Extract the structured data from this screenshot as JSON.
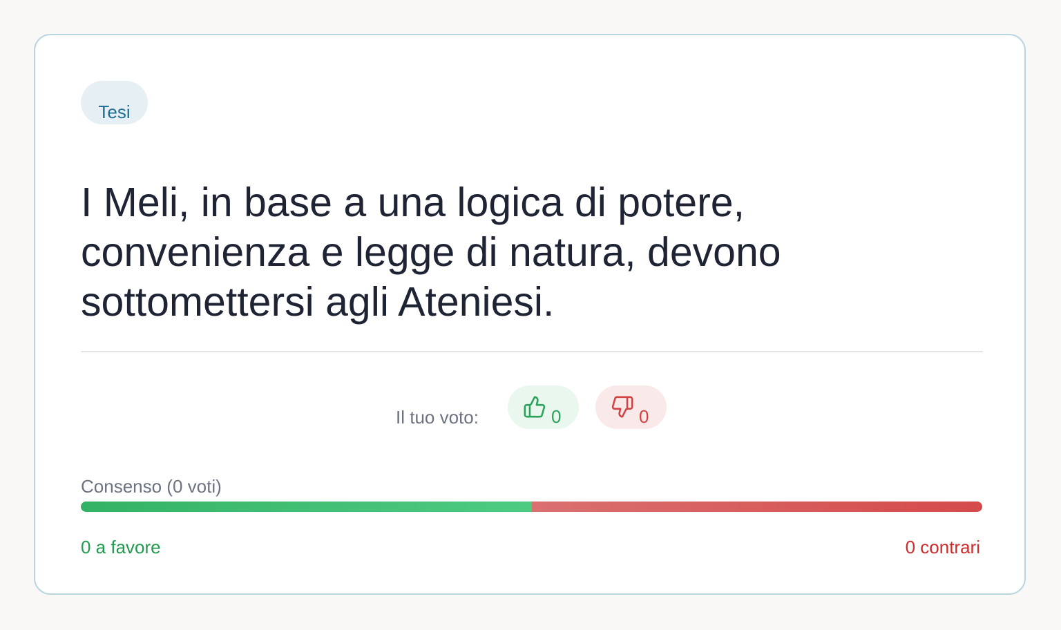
{
  "card": {
    "tag": "Tesi",
    "thesis": "I Meli, in base a una logica di potere, convenienza e legge di natura, devono sottomettersi agli Ateniesi."
  },
  "vote": {
    "label": "Il tuo voto:",
    "up": {
      "icon": "thumbs-up-icon",
      "count": "0",
      "color": "#2aa35a"
    },
    "down": {
      "icon": "thumbs-down-icon",
      "count": "0",
      "color": "#d14343"
    }
  },
  "consensus": {
    "label": "Consenso (0 voti)",
    "favor_fraction": 0.5,
    "favor_text": "0 a favore",
    "against_text": "0 contrari",
    "favor_color": "#34b263",
    "against_color": "#d54a4a"
  }
}
